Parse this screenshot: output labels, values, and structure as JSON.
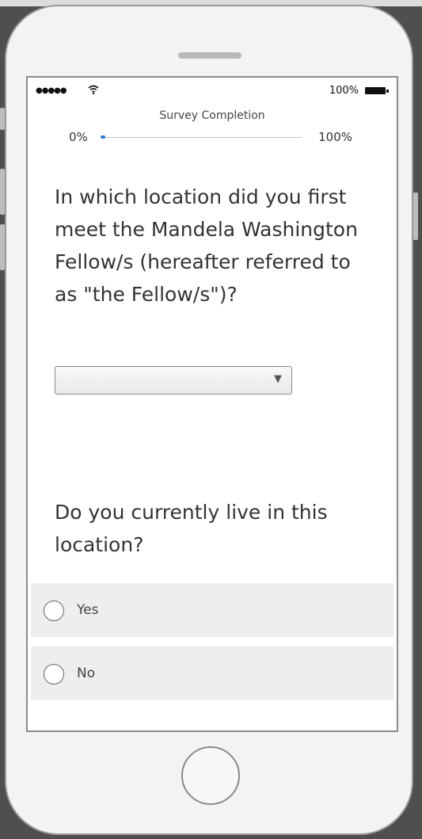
{
  "status_bar": {
    "signal": "●●●●●",
    "battery_percent": "100%"
  },
  "progress": {
    "title": "Survey Completion",
    "start_label": "0%",
    "end_label": "100%",
    "value_fraction": 0.02,
    "accent_color": "#2f7fd8"
  },
  "questions": {
    "q1": {
      "text": "In which location did you first meet the Mandela Washington Fellow/s (hereafter referred to as \"the Fellow/s\")?",
      "dropdown_value": "",
      "dropdown_arrow": "▼"
    },
    "q2": {
      "text": "Do you currently live in this location?",
      "options": [
        {
          "label": "Yes"
        },
        {
          "label": "No"
        }
      ]
    }
  },
  "icons": {
    "wifi": "wifi-icon",
    "battery": "battery-icon",
    "dropdown": "dropdown-arrow-icon",
    "radio": "radio-icon"
  }
}
